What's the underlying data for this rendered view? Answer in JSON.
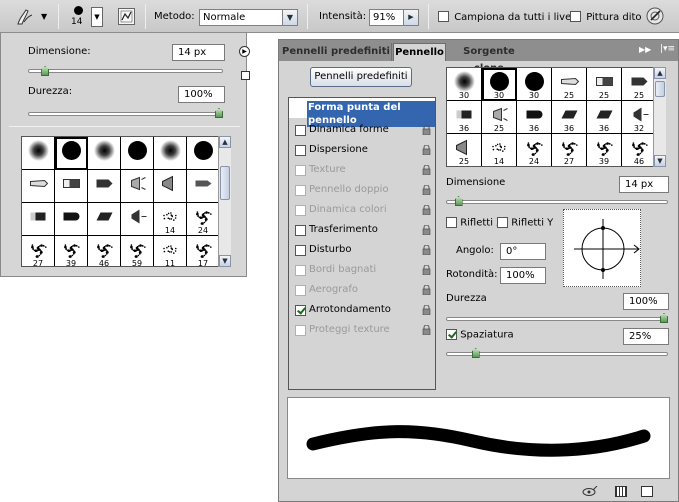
{
  "options_bar": {
    "brush_size": "14",
    "metodo_label": "Metodo:",
    "metodo_value": "Normale",
    "intensita_label": "Intensità:",
    "intensita_value": "91%",
    "campiona_label": "Campiona da tutti i livelli",
    "campiona_checked": false,
    "pittura_dito_label": "Pittura dito",
    "pittura_dito_checked": false
  },
  "preset_picker": {
    "dimensione_label": "Dimensione:",
    "dimensione_value": "14 px",
    "durezza_label": "Durezza:",
    "durezza_value": "100%",
    "dimensione_level": 0.07,
    "durezza_level": 1.0,
    "brushes": [
      [
        {
          "t": "soft",
          "n": ""
        },
        {
          "t": "hard",
          "n": ""
        },
        {
          "t": "soft",
          "n": ""
        },
        {
          "t": "hard",
          "n": ""
        },
        {
          "t": "soft",
          "n": ""
        },
        {
          "t": "hard",
          "n": ""
        }
      ],
      [
        {
          "t": "tip1",
          "n": ""
        },
        {
          "t": "tip2",
          "n": ""
        },
        {
          "t": "tip3",
          "n": ""
        },
        {
          "t": "tip4",
          "n": ""
        },
        {
          "t": "tip5",
          "n": ""
        },
        {
          "t": "tip6",
          "n": ""
        }
      ],
      [
        {
          "t": "tip7",
          "n": ""
        },
        {
          "t": "tip8",
          "n": ""
        },
        {
          "t": "tip9",
          "n": ""
        },
        {
          "t": "tip10",
          "n": ""
        },
        {
          "t": "spray",
          "n": "14"
        },
        {
          "t": "splat",
          "n": "24"
        }
      ],
      [
        {
          "t": "splat",
          "n": "27"
        },
        {
          "t": "splat",
          "n": "39"
        },
        {
          "t": "splat",
          "n": "46"
        },
        {
          "t": "splat",
          "n": "59"
        },
        {
          "t": "spray",
          "n": "11"
        },
        {
          "t": "splat",
          "n": "17"
        }
      ]
    ]
  },
  "brush_panel": {
    "tabs": [
      "Pennelli predefiniti",
      "Pennello",
      "Sorgente clone"
    ],
    "active_tab": 1,
    "presets_button": "Pennelli predefiniti",
    "options": [
      {
        "label": "Forma punta del pennello",
        "checkbox": false,
        "checked": false,
        "enabled": true,
        "lock": false,
        "selected": true
      },
      {
        "label": "Dinamica forme",
        "checkbox": true,
        "checked": false,
        "enabled": true,
        "lock": true
      },
      {
        "label": "Dispersione",
        "checkbox": true,
        "checked": false,
        "enabled": true,
        "lock": true
      },
      {
        "label": "Texture",
        "checkbox": true,
        "checked": false,
        "enabled": false,
        "lock": true
      },
      {
        "label": "Pennello doppio",
        "checkbox": true,
        "checked": false,
        "enabled": false,
        "lock": true
      },
      {
        "label": "Dinamica colori",
        "checkbox": true,
        "checked": false,
        "enabled": false,
        "lock": true
      },
      {
        "label": "Trasferimento",
        "checkbox": true,
        "checked": false,
        "enabled": true,
        "lock": true
      },
      {
        "label": "Disturbo",
        "checkbox": true,
        "checked": false,
        "enabled": true,
        "lock": true
      },
      {
        "label": "Bordi bagnati",
        "checkbox": true,
        "checked": false,
        "enabled": false,
        "lock": true
      },
      {
        "label": "Aerografo",
        "checkbox": true,
        "checked": false,
        "enabled": false,
        "lock": true
      },
      {
        "label": "Arrotondamento",
        "checkbox": true,
        "checked": true,
        "enabled": true,
        "lock": true
      },
      {
        "label": "Proteggi texture",
        "checkbox": true,
        "checked": false,
        "enabled": false,
        "lock": true
      }
    ],
    "brushes": [
      [
        {
          "t": "soft",
          "n": "30"
        },
        {
          "t": "hard",
          "n": "30"
        },
        {
          "t": "hard",
          "n": "30"
        },
        {
          "t": "tip1",
          "n": "25"
        },
        {
          "t": "tip2",
          "n": "25"
        },
        {
          "t": "tip3",
          "n": "25"
        }
      ],
      [
        {
          "t": "tip7",
          "n": "36"
        },
        {
          "t": "tip4",
          "n": "25"
        },
        {
          "t": "tip8",
          "n": "36"
        },
        {
          "t": "tip9",
          "n": "36"
        },
        {
          "t": "tip9",
          "n": "36"
        },
        {
          "t": "tip10",
          "n": "32"
        }
      ],
      [
        {
          "t": "tip5",
          "n": "25"
        },
        {
          "t": "spray",
          "n": "14"
        },
        {
          "t": "splat",
          "n": "24"
        },
        {
          "t": "splat",
          "n": "27"
        },
        {
          "t": "splat",
          "n": "39"
        },
        {
          "t": "splat",
          "n": "46"
        }
      ]
    ],
    "dimensione_label": "Dimensione",
    "dimensione_value": "14 px",
    "dimensione_level": 0.04,
    "rifletti_x_label": "Rifletti X",
    "rifletti_y_label": "Rifletti Y",
    "angolo_label": "Angolo:",
    "angolo_value": "0°",
    "rotondita_label": "Rotondità:",
    "rotondita_value": "100%",
    "durezza_label": "Durezza",
    "durezza_value": "100%",
    "durezza_level": 1.0,
    "spaziatura_label": "Spaziatura",
    "spaziatura_checked": true,
    "spaziatura_value": "25%",
    "spaziatura_level": 0.12
  }
}
